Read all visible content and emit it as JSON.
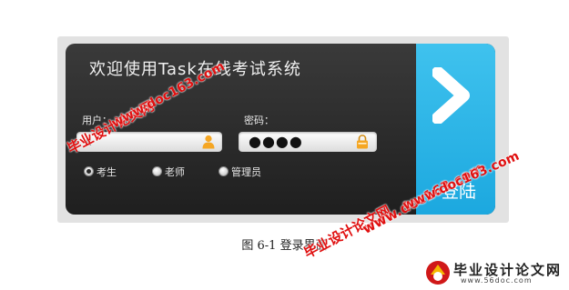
{
  "login_panel": {
    "title": "欢迎使用Task在线考试系统",
    "username_label": "用户：",
    "username_value": "k",
    "password_label": "密码：",
    "password_mask": "●●●●",
    "username_icon": "user-icon",
    "password_icon": "lock-icon",
    "roles": [
      {
        "label": "考生",
        "checked": true
      },
      {
        "label": "老师",
        "checked": false
      },
      {
        "label": "管理员",
        "checked": false
      }
    ],
    "login_label": "登陆",
    "login_icon": "chevron-right-icon",
    "colors": {
      "panel": "#2c2c2c",
      "login_button": "#2bb5e8",
      "field_icon": "#f5a623"
    }
  },
  "caption": "图 6-1  登录界面",
  "watermarks": {
    "site_cn": "毕业设计论文网",
    "site_url": "www.doc163.com"
  },
  "logo": {
    "name": "毕业设计论文网",
    "url": "www.56doc.com"
  }
}
